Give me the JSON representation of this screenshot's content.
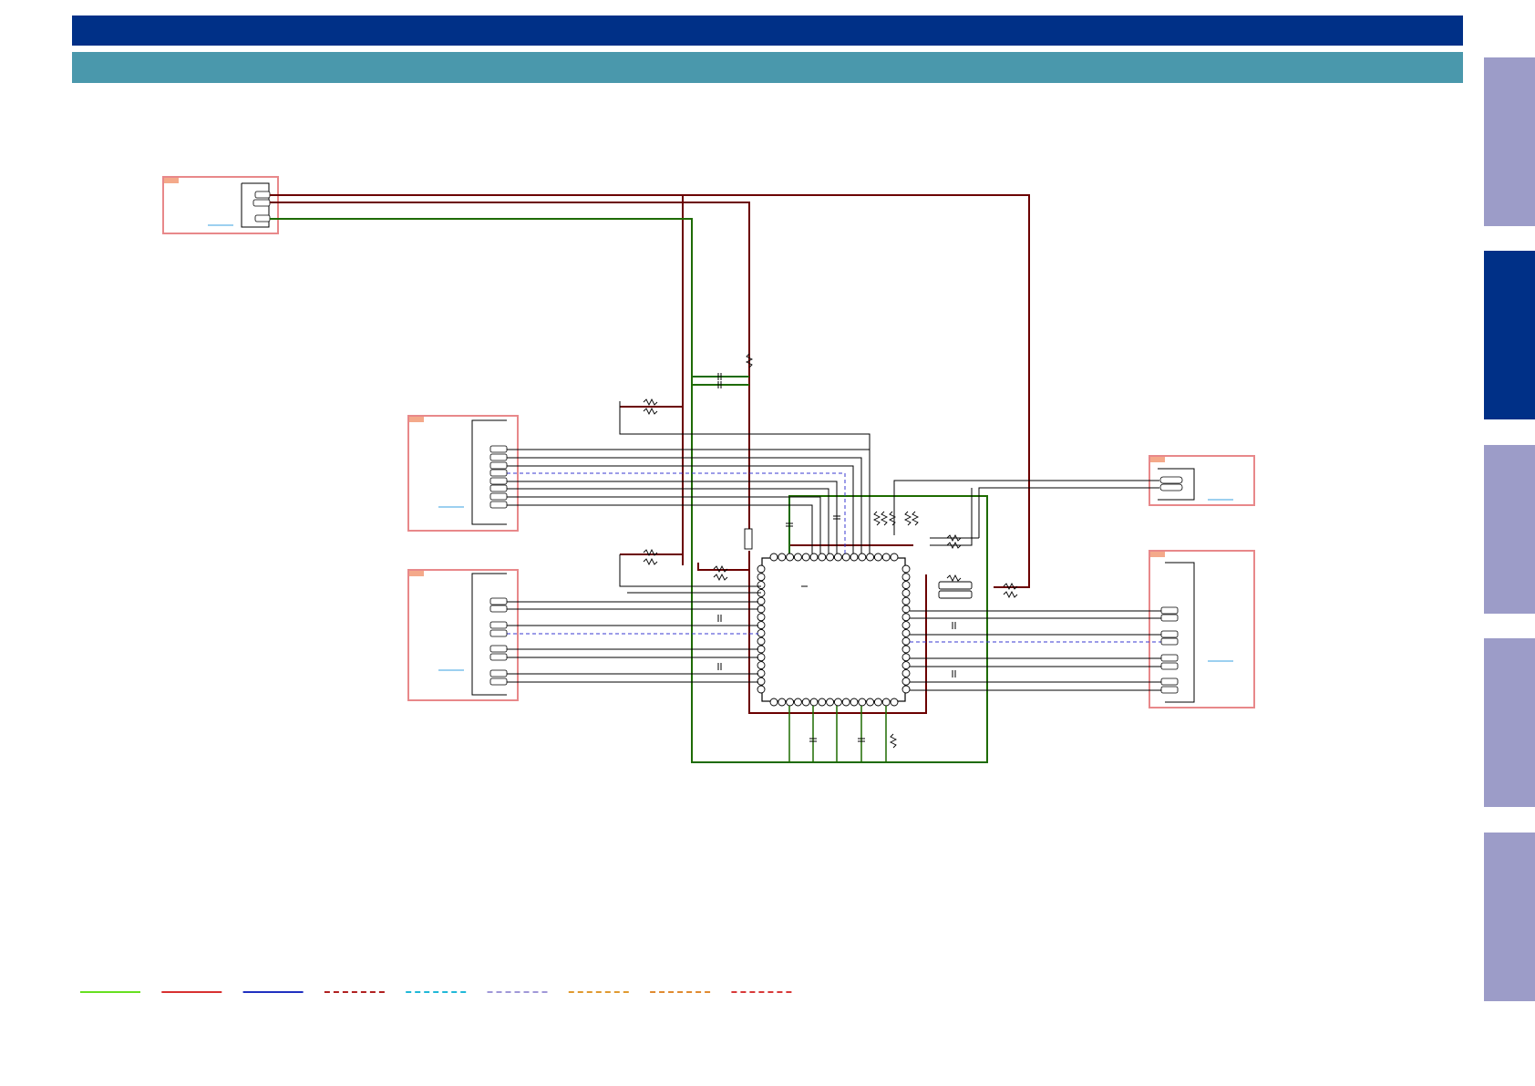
{
  "colors": {
    "header_bar": "#003087",
    "sub_header_bar": "#4A98AC",
    "side_tab_inactive": "#9C9CC8",
    "side_tab_active": "#003087",
    "wire_power": "#6B0000",
    "wire_ground": "#1E6B00",
    "wire_signal": "#000000",
    "wire_dashed_blue": "#3A3AD0",
    "block_border": "#E8888A",
    "block_tag": "#F4A98A",
    "connector_link": "#3AA0E0"
  },
  "side_tabs": [
    {
      "name": "side-tab-1",
      "active": false
    },
    {
      "name": "side-tab-2",
      "active": true
    },
    {
      "name": "side-tab-3",
      "active": false
    },
    {
      "name": "side-tab-4",
      "active": false
    },
    {
      "name": "side-tab-5",
      "active": false
    }
  ],
  "legend": [
    {
      "name": "legend-line-1",
      "color": "#66E020",
      "style": "solid"
    },
    {
      "name": "legend-line-2",
      "color": "#D83030",
      "style": "solid"
    },
    {
      "name": "legend-line-3",
      "color": "#2030C0",
      "style": "solid"
    },
    {
      "name": "legend-line-4",
      "color": "#B02020",
      "style": "dashed"
    },
    {
      "name": "legend-line-5",
      "color": "#20B8D8",
      "style": "dashed"
    },
    {
      "name": "legend-line-6",
      "color": "#A098D8",
      "style": "dashed"
    },
    {
      "name": "legend-line-7",
      "color": "#E09A30",
      "style": "dashed"
    },
    {
      "name": "legend-line-8",
      "color": "#E08A30",
      "style": "dashed"
    },
    {
      "name": "legend-line-9",
      "color": "#D83838",
      "style": "dashed"
    }
  ]
}
